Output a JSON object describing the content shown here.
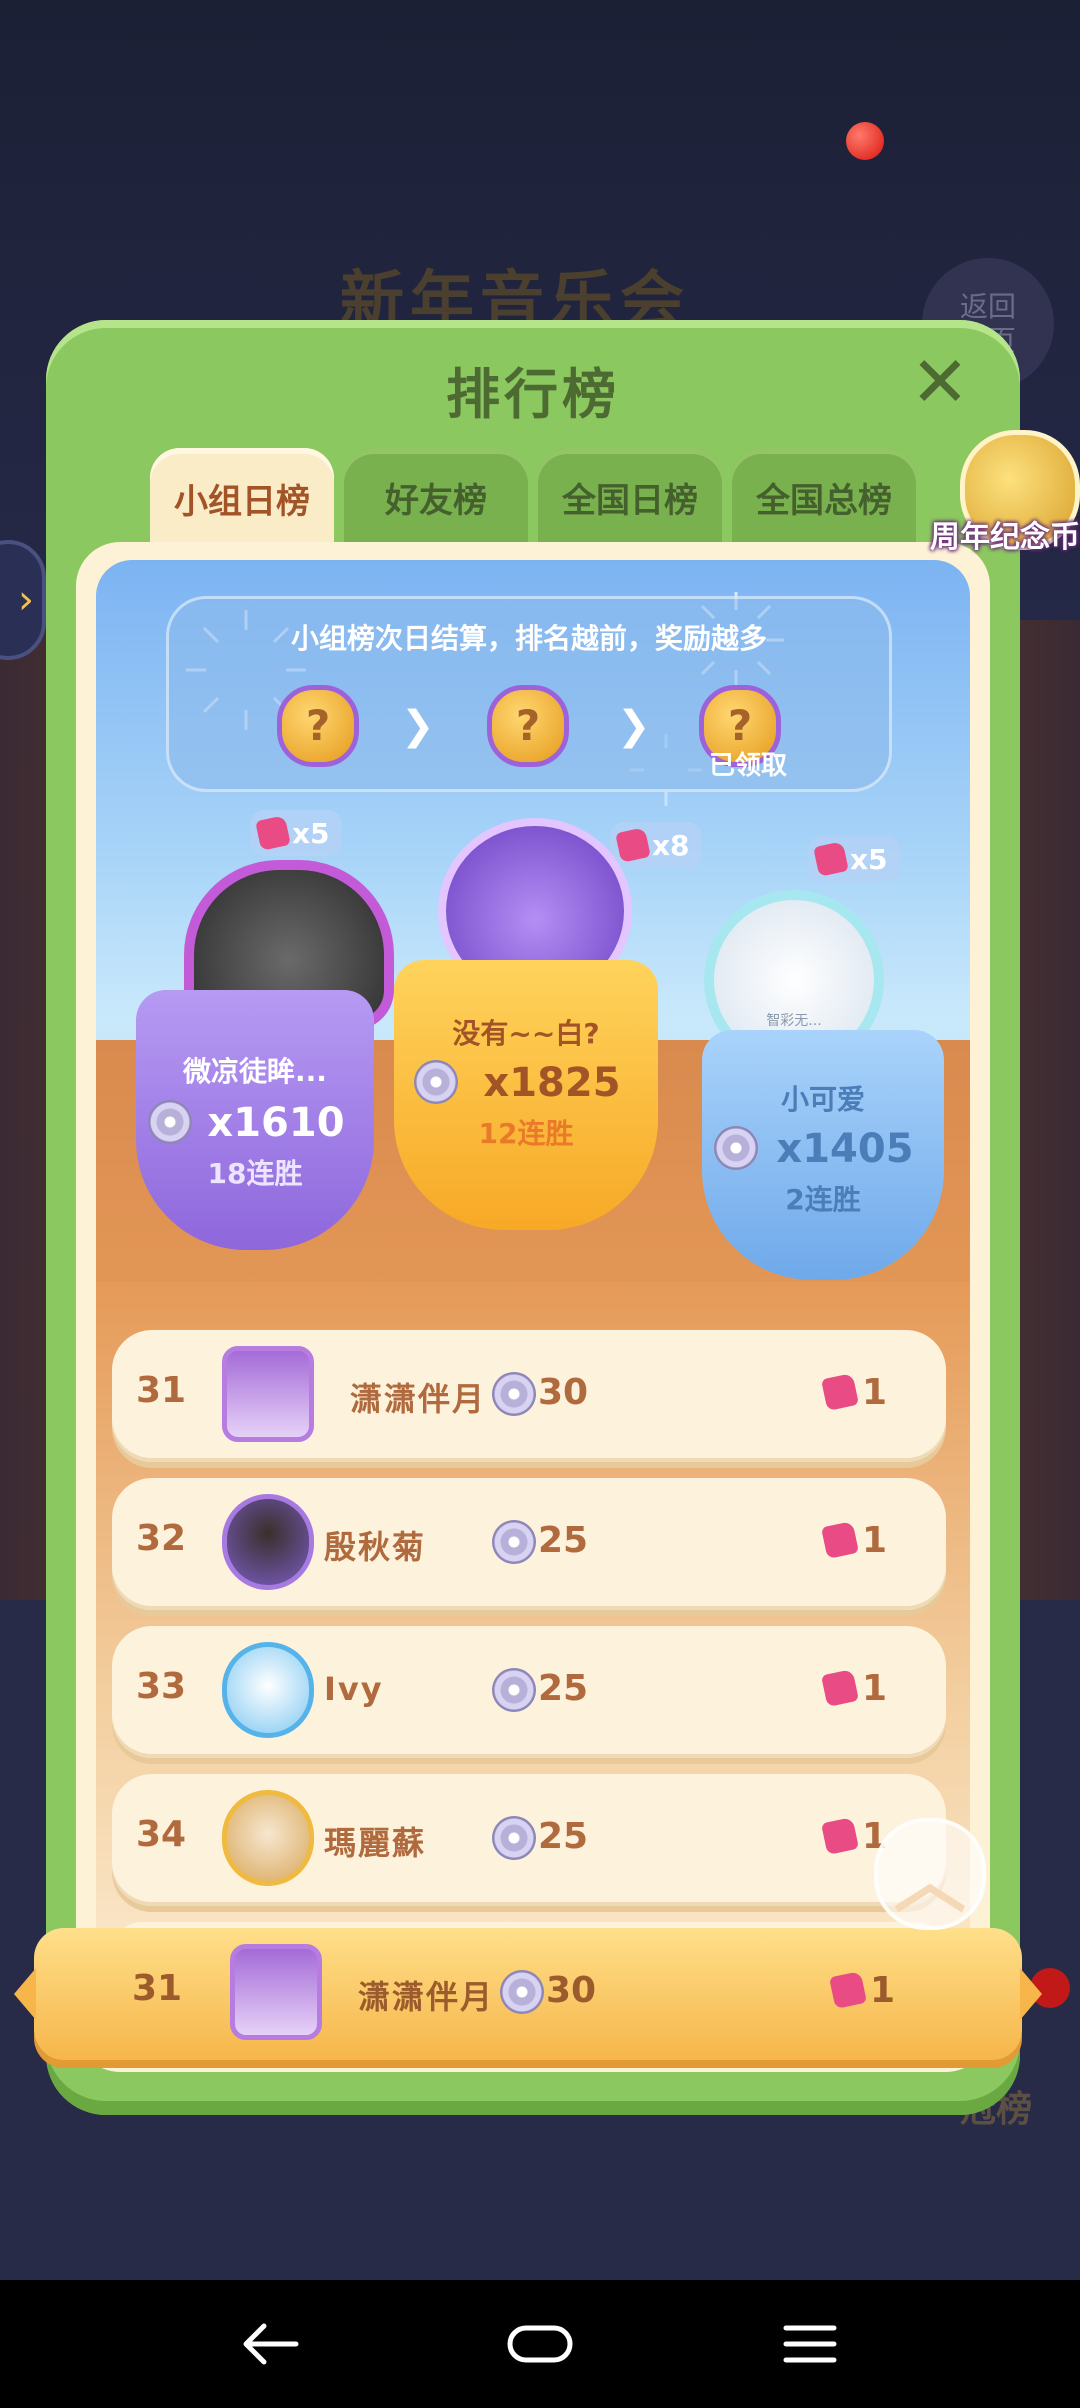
{
  "background": {
    "event_title": "新年音乐会",
    "back_label": "返回\n主页",
    "bottom_text": "冠榜"
  },
  "panel": {
    "title": "排行榜",
    "close_icon": "close-icon"
  },
  "tabs": [
    {
      "label": "小组日榜",
      "active": true
    },
    {
      "label": "好友榜",
      "active": false
    },
    {
      "label": "全国日榜",
      "active": false
    },
    {
      "label": "全国总榜",
      "active": false
    }
  ],
  "side_widget": {
    "label": "周年纪念币"
  },
  "reward_banner": {
    "text": "小组榜次日结算，排名越前，奖励越多",
    "claimed": "已领取"
  },
  "podium": {
    "first": {
      "name": "没有~~白?",
      "score": "x1825",
      "streak": "12连胜",
      "gifts": "x8"
    },
    "second": {
      "name": "微凉徒眸...",
      "score": "x1610",
      "streak": "18连胜",
      "gifts": "x5"
    },
    "third": {
      "name": "小可爱",
      "score": "x1405",
      "streak": "2连胜",
      "gifts": "x5",
      "avatar_text": "智彩无..."
    }
  },
  "list": [
    {
      "rank": "31",
      "name": "潇潇伴月",
      "score": "30",
      "gifts": "1"
    },
    {
      "rank": "32",
      "name": "殷秋菊",
      "score": "25",
      "gifts": "1"
    },
    {
      "rank": "33",
      "name": "Ivy",
      "score": "25",
      "gifts": "1"
    },
    {
      "rank": "34",
      "name": "瑪麗蘇",
      "score": "25",
      "gifts": "1"
    }
  ],
  "my_row": {
    "rank": "31",
    "name": "潇潇伴月",
    "score": "30",
    "gifts": "1"
  },
  "colors": {
    "panel_green": "#8cc860",
    "tab_active": "#fbecc8",
    "row_bg": "#fdf3dc",
    "text_brown": "#b06a3e",
    "first_place": "#fbb43a",
    "second_place": "#9a78e0",
    "third_place": "#7eb6ef"
  }
}
